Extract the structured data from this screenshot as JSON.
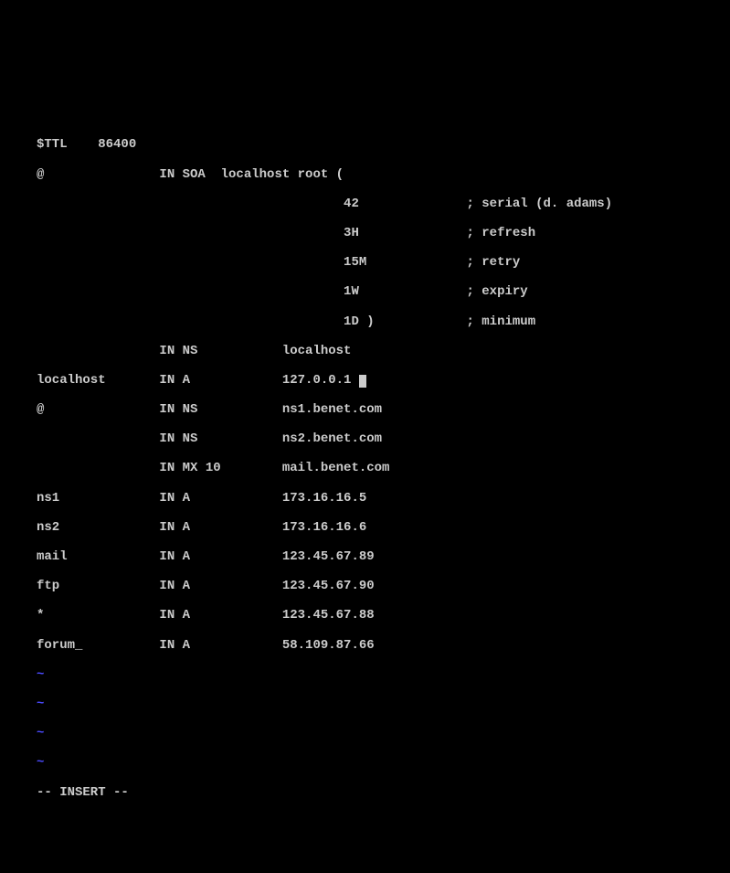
{
  "lines": {
    "l0": "$TTL    86400",
    "l1": "@               IN SOA  localhost root (",
    "l2": "                                        42              ; serial (d. adams)",
    "l3": "                                        3H              ; refresh",
    "l4": "                                        15M             ; retry",
    "l5": "                                        1W              ; expiry",
    "l6": "                                        1D )            ; minimum",
    "l7": "                IN NS           localhost",
    "l8a": "localhost       IN A            127.0.0.1 ",
    "l9": "@               IN NS           ns1.benet.com",
    "l10": "                IN NS           ns2.benet.com",
    "l11": "                IN MX 10        mail.benet.com",
    "l12": "ns1             IN A            173.16.16.5",
    "l13": "ns2             IN A            173.16.16.6",
    "l14": "mail            IN A            123.45.67.89",
    "l15": "ftp             IN A            123.45.67.90",
    "l16": "*               IN A            123.45.67.88",
    "l17": "forum_          IN A            58.109.87.66"
  },
  "tildes": {
    "t1": "~",
    "t2": "~",
    "t3": "~",
    "t4": "~"
  },
  "status": "-- INSERT --"
}
